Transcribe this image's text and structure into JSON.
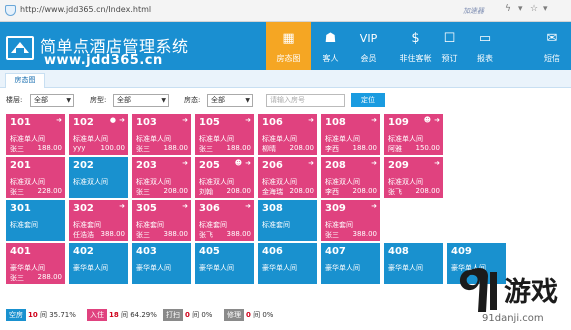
{
  "browser": {
    "url": "http://www.jdd365.cn/Index.html",
    "accelerator": "加速器"
  },
  "header": {
    "title": "简单点酒店管理系统",
    "url_text": "www.jdd365.cn",
    "nav": [
      {
        "label": "房态图",
        "icon": "grid-icon",
        "active": true
      },
      {
        "label": "客人",
        "icon": "guest-icon",
        "active": false
      },
      {
        "label": "会员",
        "icon": "vip-icon",
        "active": false
      },
      {
        "label": "非住客帐",
        "icon": "dollar-icon",
        "active": false
      },
      {
        "label": "预订",
        "icon": "booking-icon",
        "active": false
      },
      {
        "label": "报表",
        "icon": "report-icon",
        "active": false
      },
      {
        "label": "短信",
        "icon": "mail-icon",
        "active": false
      }
    ],
    "nav_glyphs": [
      "▦",
      "☗",
      "VIP",
      "$",
      "☐",
      "▭",
      "✉"
    ]
  },
  "tab": {
    "label": "房态图"
  },
  "filters": {
    "floor_label": "楼层:",
    "floor_value": "全部",
    "roomtype_label": "房型:",
    "roomtype_value": "全部",
    "status_label": "房态:",
    "status_value": "全部",
    "search_placeholder": "请输入房号",
    "query_button": "定位"
  },
  "rooms": [
    {
      "num": "101",
      "type": "标准单人间",
      "guest": "张三",
      "price": "188.00",
      "status": "occupied",
      "icons": [
        "arrow"
      ]
    },
    {
      "num": "102",
      "type": "标准单人间",
      "guest": "yyy",
      "price": "100.00",
      "status": "occupied",
      "icons": [
        "arrow",
        "dot"
      ]
    },
    {
      "num": "103",
      "type": "标准单人间",
      "guest": "张三",
      "price": "188.00",
      "status": "occupied",
      "icons": [
        "arrow"
      ]
    },
    {
      "num": "105",
      "type": "标准单人间",
      "guest": "张三",
      "price": "188.00",
      "status": "occupied",
      "icons": [
        "arrow"
      ]
    },
    {
      "num": "106",
      "type": "标准单人间",
      "guest": "柳晴",
      "price": "208.00",
      "status": "occupied",
      "icons": [
        "arrow"
      ]
    },
    {
      "num": "108",
      "type": "标准单人间",
      "guest": "李西",
      "price": "188.00",
      "status": "occupied",
      "icons": [
        "arrow"
      ]
    },
    {
      "num": "109",
      "type": "标准单人间",
      "guest": "阿雅",
      "price": "150.00",
      "status": "occupied",
      "icons": [
        "arrow",
        "person"
      ]
    },
    {
      "num": "201",
      "type": "标准双人间",
      "guest": "张三",
      "price": "228.00",
      "status": "occupied",
      "icons": []
    },
    {
      "num": "202",
      "type": "标准双人间",
      "guest": "",
      "price": "",
      "status": "vacant",
      "icons": []
    },
    {
      "num": "203",
      "type": "标准双人间",
      "guest": "张三",
      "price": "208.00",
      "status": "occupied",
      "icons": [
        "arrow"
      ]
    },
    {
      "num": "205",
      "type": "标准双人间",
      "guest": "刘翰",
      "price": "208.00",
      "status": "occupied",
      "icons": [
        "arrow",
        "person"
      ]
    },
    {
      "num": "206",
      "type": "标准双人间",
      "guest": "金海瑞",
      "price": "208.00",
      "status": "occupied",
      "icons": [
        "arrow"
      ]
    },
    {
      "num": "208",
      "type": "标准双人间",
      "guest": "李西",
      "price": "208.00",
      "status": "occupied",
      "icons": [
        "arrow"
      ]
    },
    {
      "num": "209",
      "type": "标准双人间",
      "guest": "张飞",
      "price": "208.00",
      "status": "occupied",
      "icons": [
        "arrow"
      ]
    },
    {
      "num": "301",
      "type": "标准套间",
      "guest": "",
      "price": "",
      "status": "vacant",
      "icons": []
    },
    {
      "num": "302",
      "type": "标准套间",
      "guest": "任浩浩",
      "price": "388.00",
      "status": "occupied",
      "icons": [
        "arrow"
      ]
    },
    {
      "num": "305",
      "type": "标准套间",
      "guest": "张三",
      "price": "388.00",
      "status": "occupied",
      "icons": [
        "arrow"
      ]
    },
    {
      "num": "306",
      "type": "标准套间",
      "guest": "张飞",
      "price": "388.00",
      "status": "occupied",
      "icons": [
        "arrow"
      ]
    },
    {
      "num": "308",
      "type": "标准套间",
      "guest": "",
      "price": "",
      "status": "vacant",
      "icons": []
    },
    {
      "num": "309",
      "type": "标准套间",
      "guest": "张三",
      "price": "388.00",
      "status": "occupied",
      "icons": [
        "arrow"
      ]
    },
    {
      "num": "401",
      "type": "豪华单人间",
      "guest": "张三",
      "price": "288.00",
      "status": "occupied",
      "icons": []
    },
    {
      "num": "402",
      "type": "豪华单人间",
      "guest": "",
      "price": "",
      "status": "vacant",
      "icons": []
    },
    {
      "num": "403",
      "type": "豪华单人间",
      "guest": "",
      "price": "",
      "status": "vacant",
      "icons": []
    },
    {
      "num": "405",
      "type": "豪华单人间",
      "guest": "",
      "price": "",
      "status": "vacant",
      "icons": []
    },
    {
      "num": "406",
      "type": "豪华单人间",
      "guest": "",
      "price": "",
      "status": "vacant",
      "icons": []
    },
    {
      "num": "407",
      "type": "豪华单人间",
      "guest": "",
      "price": "",
      "status": "vacant",
      "icons": []
    },
    {
      "num": "408",
      "type": "豪华单人间",
      "guest": "",
      "price": "",
      "status": "vacant",
      "icons": []
    },
    {
      "num": "409",
      "type": "豪华单人间",
      "guest": "",
      "price": "",
      "status": "vacant",
      "icons": []
    }
  ],
  "status_bar": [
    {
      "label": "空房",
      "count": "10",
      "unit": "间",
      "pct": "35.71%",
      "color": "#1991cf"
    },
    {
      "label": "入住",
      "count": "18",
      "unit": "间",
      "pct": "64.29%",
      "color": "#e0427f"
    },
    {
      "label": "打扫",
      "count": "0",
      "unit": "间",
      "pct": "0%",
      "color": "#8a8a8a"
    },
    {
      "label": "修理",
      "count": "0",
      "unit": "间",
      "pct": "0%",
      "color": "#8a8a8a"
    }
  ],
  "watermark": {
    "text": "游戏",
    "site": "91danji.com"
  },
  "colors": {
    "header": "#1a8fd1",
    "active_nav": "#f5a623",
    "occupied": "#e0427f",
    "vacant": "#1991cf"
  }
}
